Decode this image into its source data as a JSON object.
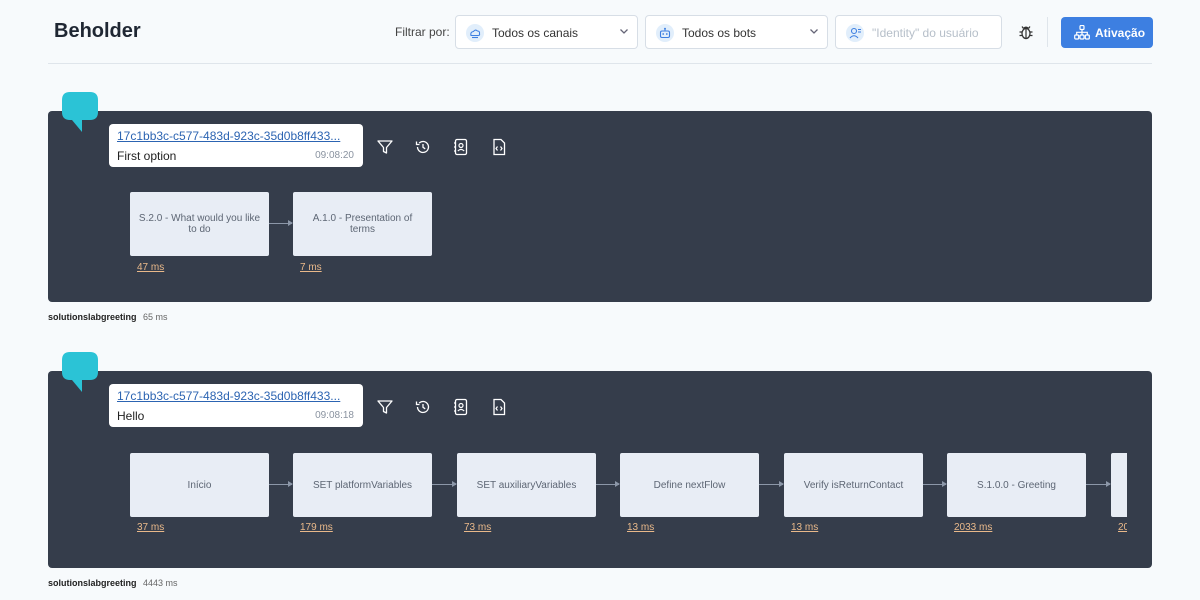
{
  "header": {
    "title": "Beholder",
    "filter_label": "Filtrar por:",
    "channel_select": "Todos os canais",
    "bot_select": "Todos os bots",
    "identity_placeholder": "\"Identity\" do usuário",
    "activation_button": "Ativação"
  },
  "traces": [
    {
      "id": "17c1bb3c-c577-483d-923c-35d0b8ff433...",
      "message": "First option",
      "time": "09:08:20",
      "bot": "solutionslabgreeting",
      "total": "65 ms",
      "nodes": [
        {
          "label": "S.2.0 - What would you like to do",
          "duration": "47 ms"
        },
        {
          "label": "A.1.0 - Presentation of terms",
          "duration": "7 ms"
        }
      ]
    },
    {
      "id": "17c1bb3c-c577-483d-923c-35d0b8ff433...",
      "message": "Hello",
      "time": "09:08:18",
      "bot": "solutionslabgreeting",
      "total": "4443 ms",
      "nodes": [
        {
          "label": "Início",
          "duration": "37 ms"
        },
        {
          "label": "SET platformVariables",
          "duration": "179 ms"
        },
        {
          "label": "SET auxiliaryVariables",
          "duration": "73 ms"
        },
        {
          "label": "Define nextFlow",
          "duration": "13 ms"
        },
        {
          "label": "Verify isReturnContact",
          "duration": "13 ms"
        },
        {
          "label": "S.1.0.0 - Greeting",
          "duration": "2033 ms"
        },
        {
          "label": "",
          "duration": "20"
        }
      ]
    }
  ],
  "icons": {
    "chat": "chat-bubble-icon",
    "filter": "filter-icon",
    "history": "history-icon",
    "contact": "contact-icon",
    "code": "code-icon"
  },
  "colors": {
    "panel": "#353d4b",
    "accent": "#3d7fe1",
    "bubble": "#2bc3d6",
    "node": "#e8edf5",
    "duration": "#e9b98a"
  }
}
